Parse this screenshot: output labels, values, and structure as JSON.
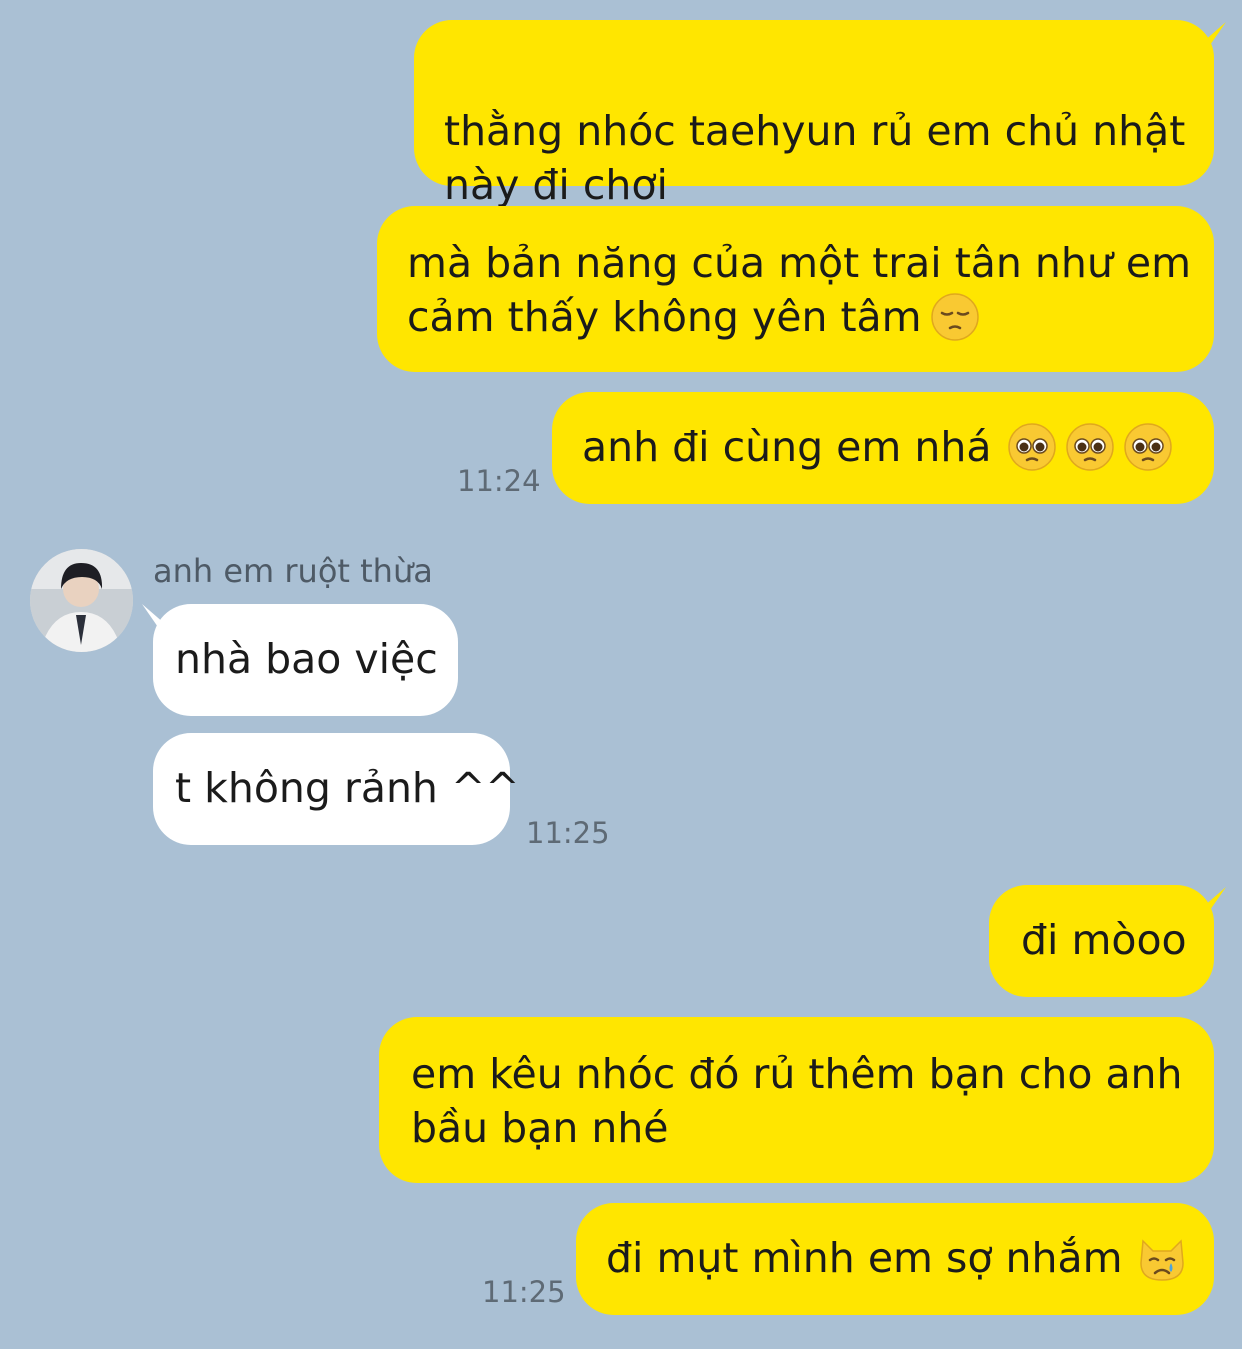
{
  "messages": {
    "m1": "thằng nhóc taehyun rủ em chủ nhật\nnày đi chơi",
    "m2_line1": "mà bản năng của một trai tân như em",
    "m2_line2": "cảm thấy không yên tâm",
    "m3": "anh đi cùng em nhá",
    "time1": "11:24",
    "sender": "anh em ruột thừa",
    "m4": "nhà bao việc",
    "m5": "t không rảnh ^^",
    "time2": "11:25",
    "m6": "đi mòoo",
    "m7_line1": "em kêu nhóc đó rủ thêm bạn cho anh",
    "m7_line2": "bầu bạn nhé",
    "m8": "đi mụt mình em sợ nhắm",
    "time3": "11:25"
  },
  "icons": {
    "pensive": "pensive-face-emoji",
    "pleading": "pleading-face-emoji",
    "crying_cat": "crying-cat-emoji"
  },
  "colors": {
    "background": "#aac0d4",
    "outgoing": "#ffe600",
    "incoming": "#ffffff"
  }
}
